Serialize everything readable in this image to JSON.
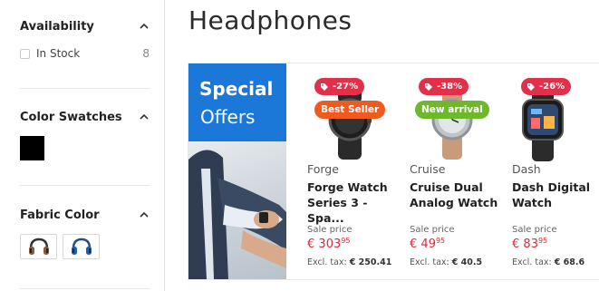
{
  "sidebar": {
    "availability": {
      "title": "Availability",
      "option_label": "In Stock",
      "option_count": "8"
    },
    "color_swatches": {
      "title": "Color Swatches",
      "swatches": [
        "#000000"
      ]
    },
    "fabric_color": {
      "title": "Fabric Color"
    }
  },
  "main": {
    "title": "Headphones",
    "banner": {
      "title": "Special",
      "subtitle": "Offers"
    },
    "products": [
      {
        "discount": "-27%",
        "badge": "Best Seller",
        "badge_color": "#f05a1e",
        "brand": "Forge",
        "name": "Forge Watch Series 3 - Spa...",
        "sale_label": "Sale price",
        "price_currency": "€",
        "price_main": "303",
        "price_cents": "95",
        "excl_label": "Excl. tax:",
        "excl_value": "€ 250.41"
      },
      {
        "discount": "-38%",
        "badge": "New arrival",
        "badge_color": "#6db82b",
        "brand": "Cruise",
        "name": "Cruise Dual Analog Watch",
        "sale_label": "Sale price",
        "price_currency": "€",
        "price_main": "49",
        "price_cents": "95",
        "excl_label": "Excl. tax:",
        "excl_value": "€ 40.5"
      },
      {
        "discount": "-26%",
        "badge": "",
        "badge_color": "",
        "brand": "Dash",
        "name": "Dash Digital Watch",
        "sale_label": "Sale price",
        "price_currency": "€",
        "price_main": "83",
        "price_cents": "95",
        "excl_label": "Excl. tax:",
        "excl_value": "€ 68.6"
      }
    ]
  },
  "colors": {
    "accent_blue": "#1b78d8",
    "discount_red": "#e0304a",
    "price_red": "#e0263a"
  }
}
